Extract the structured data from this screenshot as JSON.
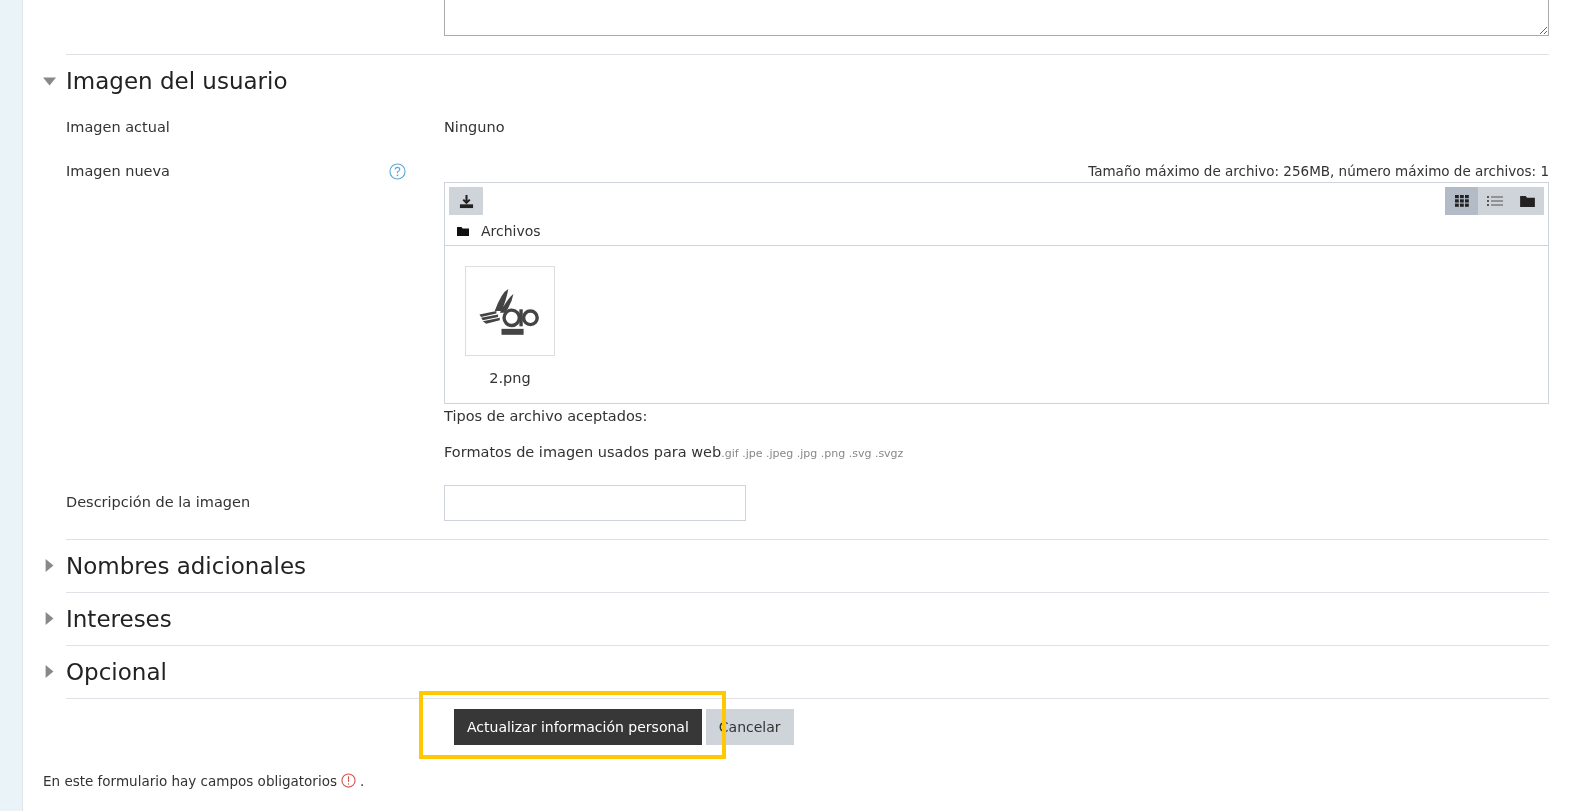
{
  "sections": [
    {
      "title": "Imagen del usuario",
      "expanded": true
    },
    {
      "title": "Nombres adicionales",
      "expanded": false
    },
    {
      "title": "Intereses",
      "expanded": false
    },
    {
      "title": "Opcional",
      "expanded": false
    }
  ],
  "current_image": {
    "label": "Imagen actual",
    "value": "Ninguno"
  },
  "new_image": {
    "label": "Imagen nueva",
    "limits": "Tamaño máximo de archivo: 256MB, número máximo de archivos: 1",
    "view_modes": [
      {
        "kind": "grid",
        "selected": true
      },
      {
        "kind": "list",
        "selected": false
      },
      {
        "kind": "tree",
        "selected": false
      }
    ],
    "path": "Archivos",
    "files": [
      {
        "name": "2.png"
      }
    ],
    "accepted_label": "Tipos de archivo aceptados:",
    "accepted_group": "Formatos de imagen usados para web",
    "accepted_extensions": ".gif .jpe .jpeg .jpg .png .svg .svgz"
  },
  "image_description": {
    "label": "Descripción de la imagen"
  },
  "buttons": [
    {
      "label": "Actualizar información personal",
      "kind": "primary",
      "highlighted": true
    },
    {
      "label": "Cancelar",
      "kind": "secondary",
      "highlighted": false
    }
  ],
  "required_note": {
    "text": "En este formulario hay campos obligatorios",
    "suffix": "."
  }
}
